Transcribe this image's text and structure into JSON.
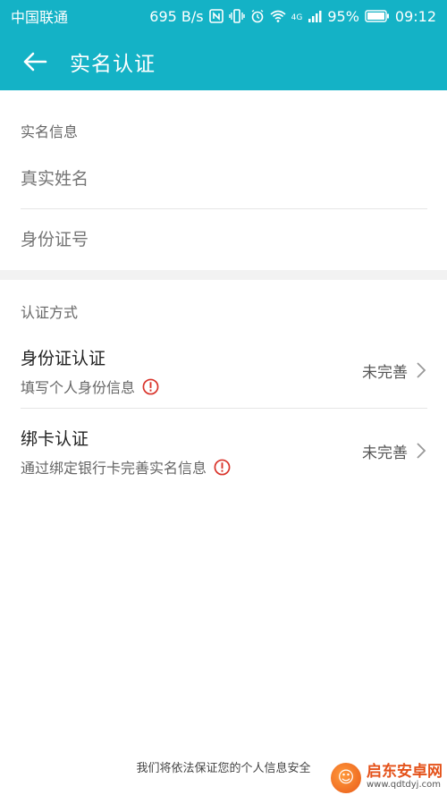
{
  "status_bar": {
    "carrier": "中国联通",
    "speed": "695 B/s",
    "network": "4G",
    "battery": "95%",
    "time": "09:12"
  },
  "header": {
    "title": "实名认证",
    "color": "#14b2c6"
  },
  "real_name_info": {
    "section_label": "实名信息",
    "name_placeholder": "真实姓名",
    "id_placeholder": "身份证号"
  },
  "auth_methods": {
    "section_label": "认证方式",
    "items": [
      {
        "title": "身份证认证",
        "description": "填写个人身份信息",
        "status": "未完善"
      },
      {
        "title": "绑卡认证",
        "description": "通过绑定银行卡完善实名信息",
        "status": "未完善"
      }
    ]
  },
  "footer": {
    "note": "我们将依法保证您的个人信息安全"
  },
  "watermark": {
    "title": "启东安卓网",
    "url": "www.qdtdyj.com"
  },
  "colors": {
    "accent": "#14b2c6",
    "warning": "#d9342b"
  }
}
